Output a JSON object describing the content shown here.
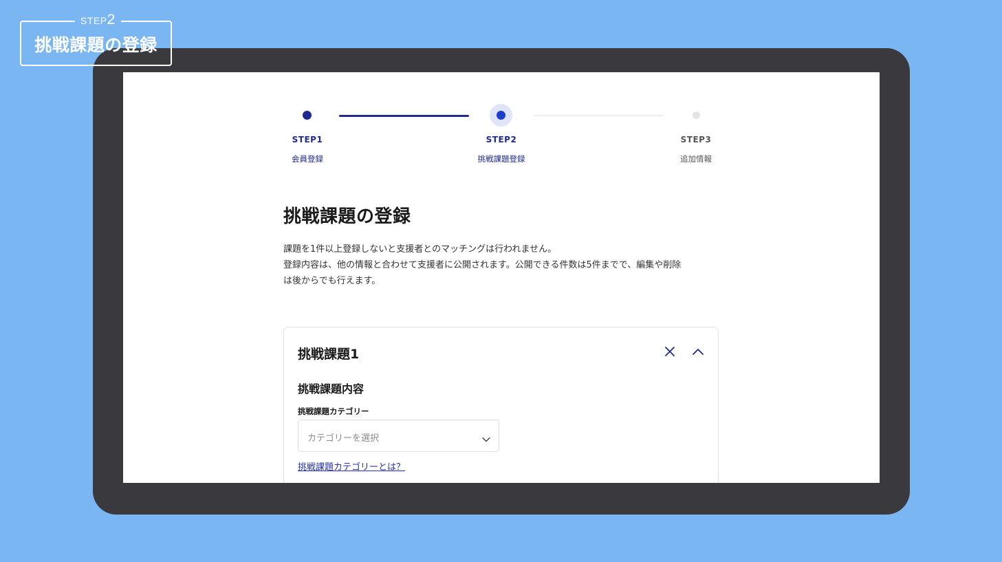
{
  "caption": {
    "step_prefix": "STEP",
    "step_number": "2",
    "title": "挑戦課題の登録"
  },
  "stepper": {
    "steps": [
      {
        "label": "STEP1",
        "sub": "会員登録",
        "state": "done"
      },
      {
        "label": "STEP2",
        "sub": "挑戦課題登録",
        "state": "active"
      },
      {
        "label": "STEP3",
        "sub": "追加情報",
        "state": "todo"
      }
    ]
  },
  "main": {
    "title": "挑戦課題の登録",
    "description": [
      "課題を1件以上登録しないと支援者とのマッチングは行われません。",
      "登録内容は、他の情報と合わせて支援者に公開されます。公開できる件数は5件までで、編集や削除",
      "は後からでも行えます。"
    ],
    "card": {
      "title": "挑戦課題1",
      "section_title": "挑戦課題内容",
      "category_label": "挑戦課題カテゴリー",
      "category_placeholder": "カテゴリーを選択",
      "help_link": "挑戦課題カテゴリーとは？"
    }
  },
  "icons": {
    "close": "close-icon",
    "collapse": "chevron-up-icon",
    "dropdown": "chevron-down-icon"
  },
  "colors": {
    "background": "#79b6f2",
    "accent": "#1e2a8f",
    "active_dot": "#1e40c8",
    "link": "#2533a8"
  }
}
